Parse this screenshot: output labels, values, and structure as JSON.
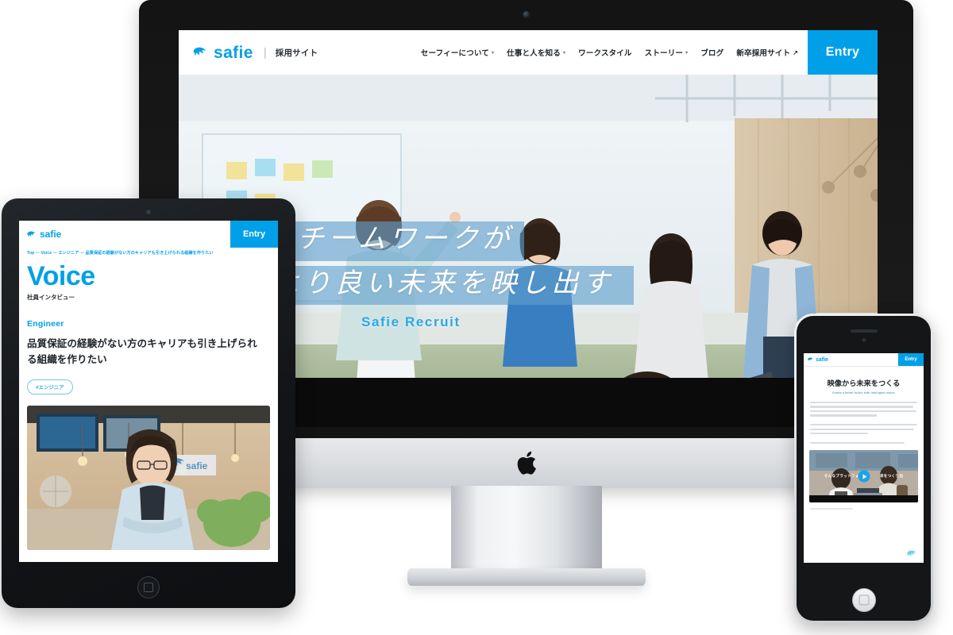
{
  "brand": {
    "name": "safie",
    "divider": "|",
    "subtitle": "採用サイト",
    "logo_icon": "safie-bird-icon",
    "accent_color": "#00a0e9"
  },
  "desktop": {
    "nav": [
      {
        "label": "セーフィーについて",
        "has_dropdown": true,
        "external": false
      },
      {
        "label": "仕事と人を知る",
        "has_dropdown": true,
        "external": false
      },
      {
        "label": "ワークスタイル",
        "has_dropdown": false,
        "external": false
      },
      {
        "label": "ストーリー",
        "has_dropdown": true,
        "external": false
      },
      {
        "label": "ブログ",
        "has_dropdown": false,
        "external": false
      },
      {
        "label": "新卒採用サイト",
        "has_dropdown": false,
        "external": true
      }
    ],
    "caret_glyph": "▾",
    "external_glyph": "↗",
    "entry_label": "Entry",
    "hero": {
      "line1": "チームワークが",
      "line2": "より良い未来を映し出す",
      "tagline": "Safie Recruit",
      "photo_alt": "オフィスでホワイトボードを囲むチームの写真"
    }
  },
  "tablet": {
    "entry_label": "Entry",
    "breadcrumb": "Top － Voice － エンジニア － 品質保証の経験がない方のキャリアも引き上げられる組織を作りたい",
    "page_title": "Voice",
    "page_subtitle": "社員インタビュー",
    "role": "Engineer",
    "headline": "品質保証の経験がない方のキャリアも引き上げられる組織を作りたい",
    "tags": [
      "#エンジニア"
    ],
    "photo_alt": "オフィスで腕を組む社員のポートレート写真",
    "photo_sign_text": "safie"
  },
  "phone": {
    "entry_label": "Entry",
    "heading": "映像から未来をつくる",
    "heading_sub": "Create a better future with intelligent vision",
    "paragraph_line_widths": [
      100,
      96,
      99,
      62,
      0,
      100,
      97,
      54,
      0,
      88
    ],
    "video_caption_left": "そんなプラットフォー",
    "video_caption_right": "来をつくり出",
    "play_icon": "play-icon",
    "mark_icon": "safie-bird-icon"
  },
  "devices": {
    "imac_label": "iMac",
    "imac_logo_icon": "apple-logo-icon",
    "ipad_label": "iPad",
    "ipad_home_icon": "home-button-icon",
    "iphone_label": "iPhone",
    "iphone_home_icon": "home-button-icon"
  }
}
